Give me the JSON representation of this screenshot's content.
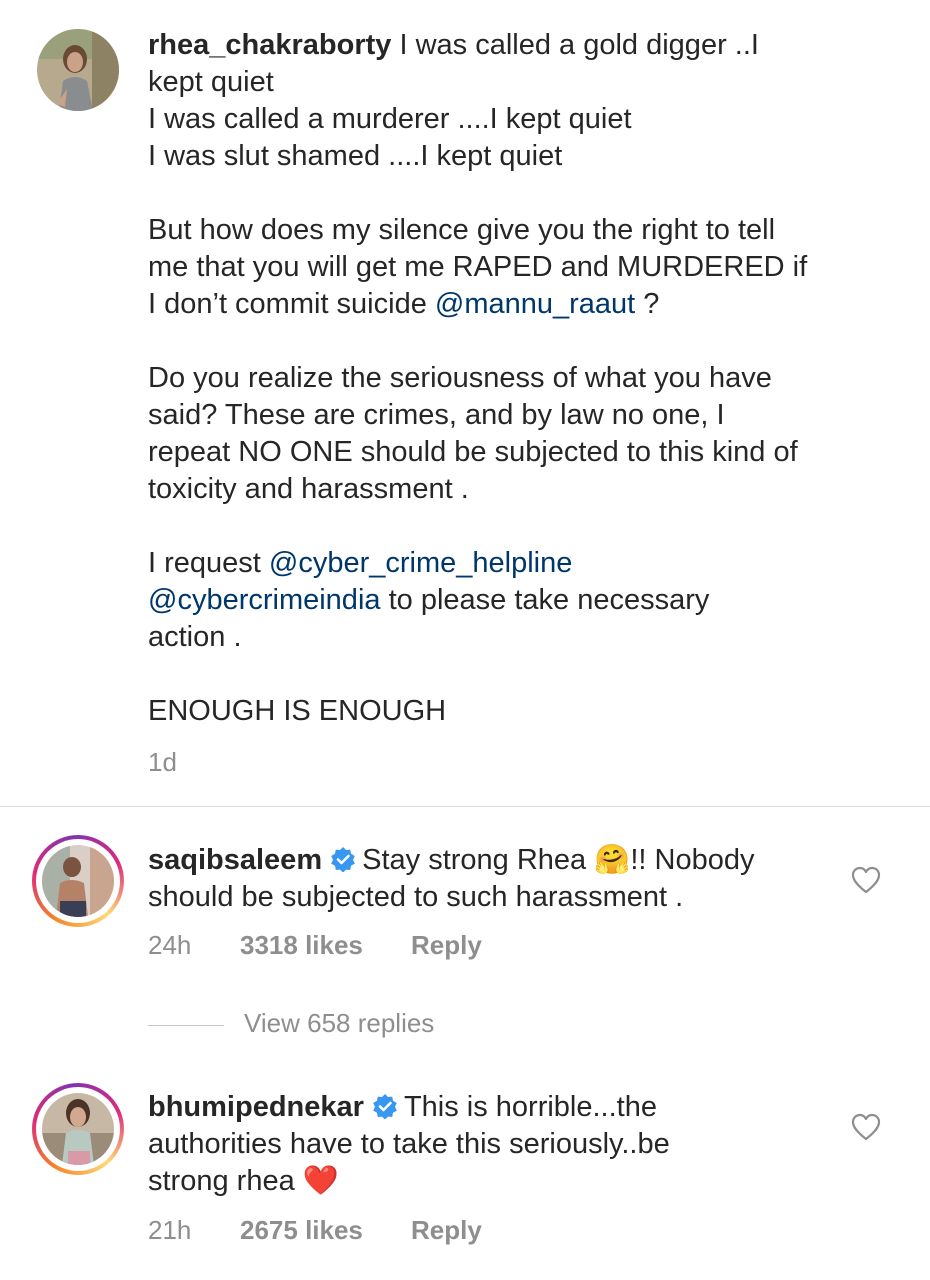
{
  "comments": [
    {
      "username": "rhea_chakraborty",
      "lines": [
        "I was called a gold digger ..I",
        "kept quiet",
        "I was called  a murderer ....I kept quiet",
        "I was slut shamed ....I kept  quiet",
        "",
        "But how does my silence give you the right to tell",
        "me that you will get me RAPED and MURDERED if",
        "I don’t commit suicide",
        "",
        "Do you realize the seriousness of what you have",
        "said? These are crimes, and by law no one, I",
        "repeat NO ONE should be subjected to this kind of",
        "toxicity and harassment .",
        "",
        "I request",
        "to please take necessary",
        "action .",
        "",
        "ENOUGH IS ENOUGH"
      ],
      "mention_1": "@mannu_raaut",
      "after_mention_1": " ?",
      "mention_2": "@cyber_crime_helpline",
      "mention_3": "@cybercrimeindia",
      "time": "1d"
    },
    {
      "username": "saqibsaleem",
      "verified": true,
      "text_1": "Stay strong Rhea",
      "emoji": "🤗",
      "text_2": "!! Nobody",
      "line_2": "should be subjected to such harassment .",
      "time": "24h",
      "likes": "3318 likes",
      "reply": "Reply"
    },
    {
      "username": "bhumipednekar",
      "verified": true,
      "text_1": "This is horrible...the",
      "line_2": "authorities have to take this seriously..be",
      "line_3": "strong rhea",
      "emoji": "❤️",
      "time": "21h",
      "likes": "2675 likes",
      "reply": "Reply"
    }
  ],
  "view_replies": "View 658 replies",
  "icons": {
    "verified": "verified-badge-icon",
    "like": "heart-outline-icon"
  },
  "colors": {
    "text": "#262626",
    "muted": "#8e8e8e",
    "mention": "#00376b",
    "verified": "#3897f0"
  }
}
